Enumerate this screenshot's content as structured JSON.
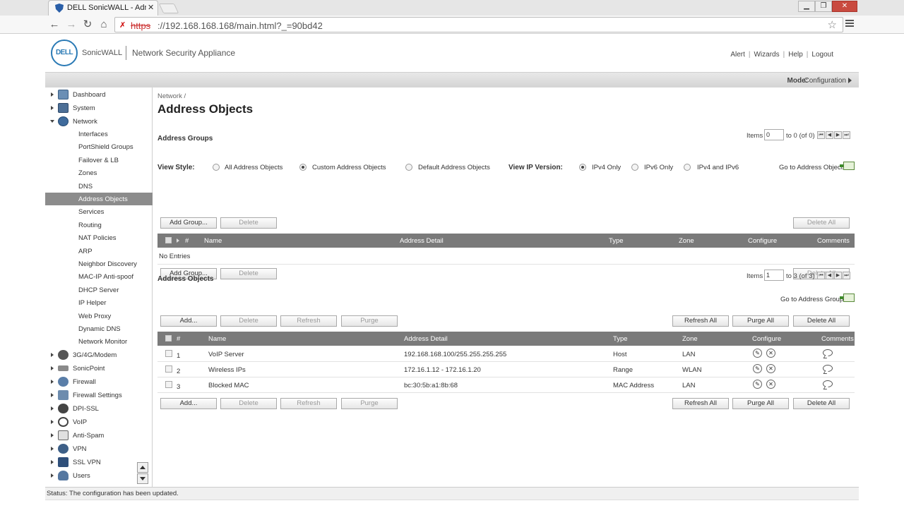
{
  "browser": {
    "tab_title": "DELL SonicWALL - Admin",
    "url_scheme": "https",
    "url_rest": "://192.168.168.168/main.html?_=90bd42"
  },
  "header": {
    "logo_text": "DELL",
    "brand": "SonicWALL",
    "app_name": "Network Security Appliance",
    "links": [
      "Alert",
      "Wizards",
      "Help",
      "Logout"
    ]
  },
  "mode": {
    "label": "Mode:",
    "value": "Configuration"
  },
  "sidebar": {
    "top_items": [
      {
        "label": "Dashboard",
        "icon": "dashboard-icon"
      },
      {
        "label": "System",
        "icon": "system-icon"
      },
      {
        "label": "Network",
        "icon": "network-icon"
      },
      {
        "label": "3G/4G/Modem",
        "icon": "modem-icon"
      },
      {
        "label": "SonicPoint",
        "icon": "sonicpoint-icon"
      },
      {
        "label": "Firewall",
        "icon": "firewall-icon"
      },
      {
        "label": "Firewall Settings",
        "icon": "firewall-settings-icon"
      },
      {
        "label": "DPI-SSL",
        "icon": "dpi-ssl-icon"
      },
      {
        "label": "VoIP",
        "icon": "voip-icon"
      },
      {
        "label": "Anti-Spam",
        "icon": "anti-spam-icon"
      },
      {
        "label": "VPN",
        "icon": "vpn-icon"
      },
      {
        "label": "SSL VPN",
        "icon": "ssl-vpn-icon"
      },
      {
        "label": "Users",
        "icon": "users-icon"
      }
    ],
    "network_items": [
      "Interfaces",
      "PortShield Groups",
      "Failover & LB",
      "Zones",
      "DNS",
      "Address Objects",
      "Services",
      "Routing",
      "NAT Policies",
      "ARP",
      "Neighbor Discovery",
      "MAC-IP Anti-spoof",
      "DHCP Server",
      "IP Helper",
      "Web Proxy",
      "Dynamic DNS",
      "Network Monitor"
    ],
    "active": "Address Objects"
  },
  "main": {
    "breadcrumb": "Network /",
    "title": "Address Objects",
    "groups": {
      "title": "Address Groups",
      "pager": {
        "items_label": "Items",
        "current": "0",
        "range": "to 0 (of 0)"
      },
      "view_style_label": "View Style:",
      "view_style_options": [
        "All Address Objects",
        "Custom Address Objects",
        "Default Address Objects"
      ],
      "view_style_selected": 1,
      "ip_version_label": "View IP Version:",
      "ip_version_options": [
        "IPv4 Only",
        "IPv6 Only",
        "IPv4 and IPv6"
      ],
      "ip_version_selected": 0,
      "goto": "Go to Address Objects",
      "buttons": {
        "add": "Add Group...",
        "delete": "Delete",
        "delete_all": "Delete All"
      },
      "columns": [
        "#",
        "Name",
        "Address Detail",
        "Type",
        "Zone",
        "Configure",
        "Comments"
      ],
      "empty": "No Entries"
    },
    "objects": {
      "title": "Address Objects",
      "pager": {
        "items_label": "Items",
        "current": "1",
        "range": "to 3 (of 3)"
      },
      "goto": "Go to Address Groups",
      "buttons": {
        "add": "Add...",
        "delete": "Delete",
        "refresh": "Refresh",
        "purge": "Purge",
        "refresh_all": "Refresh All",
        "purge_all": "Purge All",
        "delete_all": "Delete All"
      },
      "columns": [
        "#",
        "Name",
        "Address Detail",
        "Type",
        "Zone",
        "Configure",
        "Comments"
      ],
      "rows": [
        {
          "num": "1",
          "name": "VoIP Server",
          "detail": "192.168.168.100/255.255.255.255",
          "type": "Host",
          "zone": "LAN"
        },
        {
          "num": "2",
          "name": "Wireless IPs",
          "detail": "172.16.1.12 - 172.16.1.20",
          "type": "Range",
          "zone": "WLAN"
        },
        {
          "num": "3",
          "name": "Blocked MAC",
          "detail": "bc:30:5b:a1:8b:68",
          "type": "MAC Address",
          "zone": "LAN"
        }
      ]
    }
  },
  "status": "Status: The configuration has been updated.",
  "colors": {
    "header_bg": "#7a7a7a",
    "active_nav": "#8c8c8c",
    "logo_blue": "#2a7ab5"
  }
}
